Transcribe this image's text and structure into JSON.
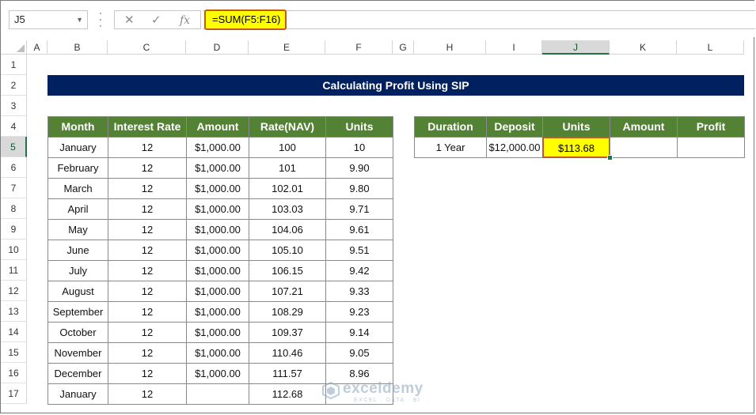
{
  "name_box": "J5",
  "formula": "=SUM(F5:F16)",
  "columns": [
    "A",
    "B",
    "C",
    "D",
    "E",
    "F",
    "G",
    "H",
    "I",
    "J",
    "K",
    "L"
  ],
  "selected_column": "J",
  "rows": [
    "1",
    "2",
    "3",
    "4",
    "5",
    "6",
    "7",
    "8",
    "9",
    "10",
    "11",
    "12",
    "13",
    "14",
    "15",
    "16",
    "17"
  ],
  "selected_row": "5",
  "title": "Calculating Profit Using SIP",
  "left_table": {
    "headers": [
      "Month",
      "Interest Rate",
      "Amount",
      "Rate(NAV)",
      "Units"
    ],
    "rows": [
      [
        "January",
        "12",
        "$1,000.00",
        "100",
        "10"
      ],
      [
        "February",
        "12",
        "$1,000.00",
        "101",
        "9.90"
      ],
      [
        "March",
        "12",
        "$1,000.00",
        "102.01",
        "9.80"
      ],
      [
        "April",
        "12",
        "$1,000.00",
        "103.03",
        "9.71"
      ],
      [
        "May",
        "12",
        "$1,000.00",
        "104.06",
        "9.61"
      ],
      [
        "June",
        "12",
        "$1,000.00",
        "105.10",
        "9.51"
      ],
      [
        "July",
        "12",
        "$1,000.00",
        "106.15",
        "9.42"
      ],
      [
        "August",
        "12",
        "$1,000.00",
        "107.21",
        "9.33"
      ],
      [
        "September",
        "12",
        "$1,000.00",
        "108.29",
        "9.23"
      ],
      [
        "October",
        "12",
        "$1,000.00",
        "109.37",
        "9.14"
      ],
      [
        "November",
        "12",
        "$1,000.00",
        "110.46",
        "9.05"
      ],
      [
        "December",
        "12",
        "$1,000.00",
        "111.57",
        "8.96"
      ],
      [
        "January",
        "12",
        "",
        "112.68",
        ""
      ]
    ]
  },
  "right_table": {
    "headers": [
      "Duration",
      "Deposit",
      "Units",
      "Amount",
      "Profit"
    ],
    "row": [
      "1 Year",
      "$12,000.00",
      "$113.68",
      "",
      ""
    ]
  },
  "icons": {
    "cancel": "✕",
    "enter": "✓",
    "function": "fx"
  },
  "watermark": {
    "name": "exceldemy",
    "tagline": "EXCEL · DATA · BI"
  },
  "colors": {
    "title_bg": "#002060",
    "header_bg": "#548235",
    "highlight": "#ffff00",
    "highlight_border": "#c55a11",
    "excel_green": "#217346"
  }
}
